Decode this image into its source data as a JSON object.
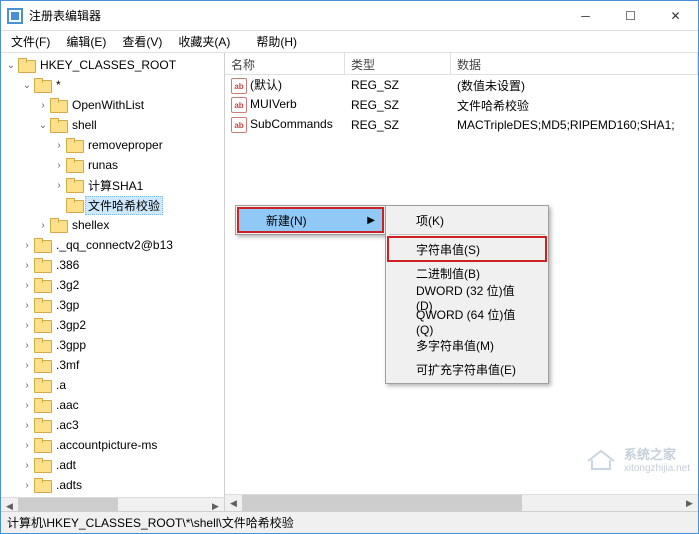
{
  "window": {
    "title": "注册表编辑器"
  },
  "menus": {
    "file": "文件(F)",
    "edit": "编辑(E)",
    "view": "查看(V)",
    "favorites": "收藏夹(A)",
    "help": "帮助(H)"
  },
  "tree": {
    "root": "HKEY_CLASSES_ROOT",
    "star": "*",
    "openwithlist": "OpenWithList",
    "shell": "shell",
    "removeproper": "removeproper",
    "runas": "runas",
    "calcsha1": "计算SHA1",
    "filehash": "文件哈希校验",
    "shellex": "shellex",
    "qq": "._qq_connectv2@b13",
    "e386": ".386",
    "e3g2": ".3g2",
    "e3gp": ".3gp",
    "e3gp2": ".3gp2",
    "e3gpp": ".3gpp",
    "e3mf": ".3mf",
    "ea": ".a",
    "eaac": ".aac",
    "eac3": ".ac3",
    "eaccount": ".accountpicture-ms",
    "eadt": ".adt",
    "eadts": ".adts"
  },
  "list": {
    "headers": {
      "name": "名称",
      "type": "类型",
      "data": "数据"
    },
    "rows": [
      {
        "name": "(默认)",
        "type": "REG_SZ",
        "data": "(数值未设置)"
      },
      {
        "name": "MUIVerb",
        "type": "REG_SZ",
        "data": "文件哈希校验"
      },
      {
        "name": "SubCommands",
        "type": "REG_SZ",
        "data": "MACTripleDES;MD5;RIPEMD160;SHA1;"
      }
    ]
  },
  "context": {
    "new": "新建(N)",
    "sub": {
      "key": "项(K)",
      "string": "字符串值(S)",
      "binary": "二进制值(B)",
      "dword": "DWORD (32 位)值(D)",
      "qword": "QWORD (64 位)值(Q)",
      "multistring": "多字符串值(M)",
      "expandstring": "可扩充字符串值(E)"
    }
  },
  "status": {
    "path": "计算机\\HKEY_CLASSES_ROOT\\*\\shell\\文件哈希校验"
  },
  "watermark": {
    "text1": "系统之家",
    "text2": "xitongzhijia.net"
  }
}
